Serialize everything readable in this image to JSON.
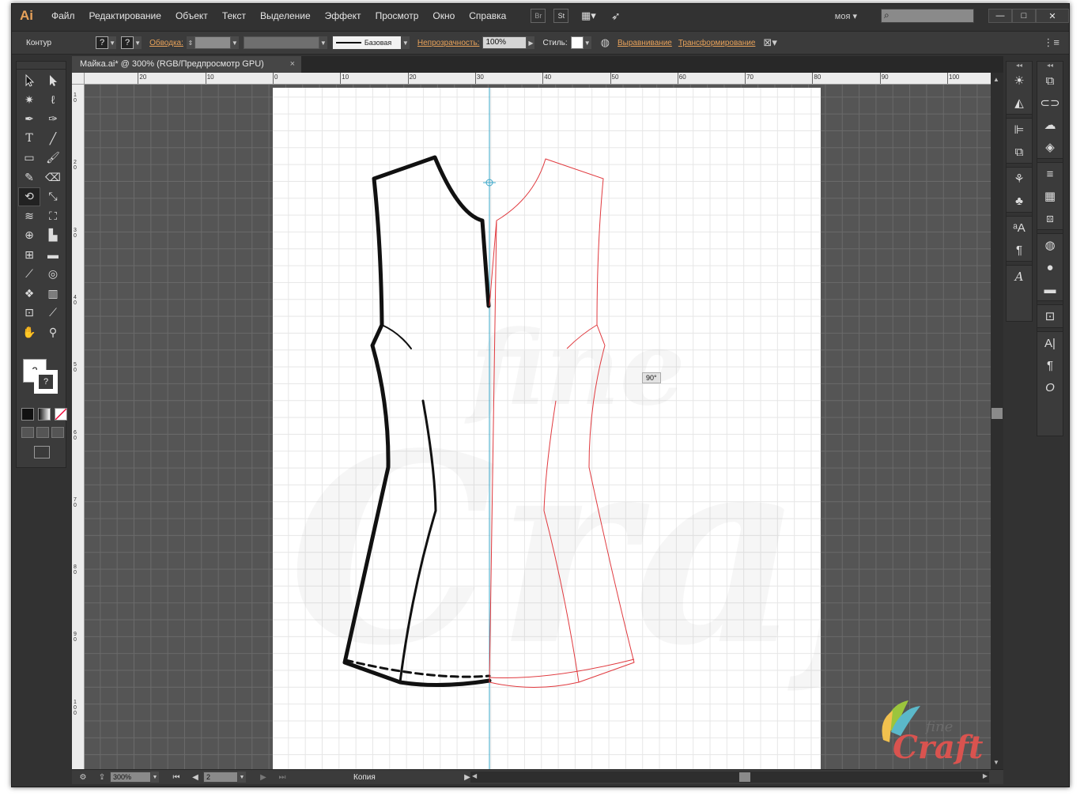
{
  "app": {
    "logo": "Ai",
    "accent": "#e8a25a"
  },
  "menu": [
    "Файл",
    "Редактирование",
    "Объект",
    "Текст",
    "Выделение",
    "Эффект",
    "Просмотр",
    "Окно",
    "Справка"
  ],
  "menu_boxes": [
    "Br",
    "St"
  ],
  "workspace": "моя",
  "window_controls": [
    "—",
    "□",
    "✕"
  ],
  "control_bar": {
    "mode_label": "Контур",
    "stroke_link": "Обводка:",
    "stroke_profile": "Базовая",
    "opacity_link": "Непрозрачность:",
    "opacity_value": "100%",
    "style_label": "Стиль:",
    "align_link": "Выравнивание",
    "transform_link": "Трансформирование"
  },
  "document_tab": {
    "title": "Майка.ai* @ 300% (RGB/Предпросмотр GPU)",
    "close": "×"
  },
  "ruler_top": [
    "20",
    "10",
    "0",
    "10",
    "20",
    "30",
    "40",
    "50",
    "60",
    "70",
    "80",
    "90",
    "100"
  ],
  "ruler_left": [
    "1 0",
    "2 0",
    "3 0",
    "4 0",
    "5 0",
    "6 0",
    "7 0",
    "8 0",
    "9 0",
    "1 0 0"
  ],
  "angle_tooltip": "90°",
  "status_bar": {
    "zoom": "300%",
    "artboard": "2",
    "status": "Копия"
  },
  "tools": [
    "selection-tool",
    "direct-selection-tool",
    "magic-wand-tool",
    "lasso-tool",
    "pen-tool",
    "curvature-tool",
    "type-tool",
    "line-tool",
    "rectangle-tool",
    "paintbrush-tool",
    "pencil-tool",
    "eraser-tool",
    "rotate-tool",
    "scale-tool",
    "warp-tool",
    "free-transform-tool",
    "shape-builder-tool",
    "perspective-grid-tool",
    "mesh-tool",
    "gradient-tool",
    "eyedropper-tool",
    "blend-tool",
    "symbol-sprayer-tool",
    "column-graph-tool",
    "artboard-tool",
    "slice-tool",
    "hand-tool",
    "zoom-tool"
  ],
  "right_panel_left": [
    "color-icon",
    "color-guide-icon",
    "align-icon",
    "pathfinder-icon",
    "brushes-icon",
    "symbols-icon",
    "graphic-styles-icon",
    "paragraph-styles-icon",
    "character-styles-icon"
  ],
  "right_panel_right": [
    "transform-icon",
    "links-icon",
    "libraries-icon",
    "layers-icon",
    "stroke-icon",
    "swatches-icon",
    "artboards-icon",
    "appearance-icon",
    "transparency-icon",
    "gradient-icon",
    "navigator-icon",
    "character-icon",
    "paragraph-icon",
    "opentype-icon"
  ],
  "watermark": {
    "word1": "fine",
    "word2": "Craft"
  },
  "colors": {
    "stroke_black": "#111111",
    "reflect_red": "#e0393e",
    "guide_cyan": "#3aa7c9",
    "canvas_grey": "#555555"
  }
}
